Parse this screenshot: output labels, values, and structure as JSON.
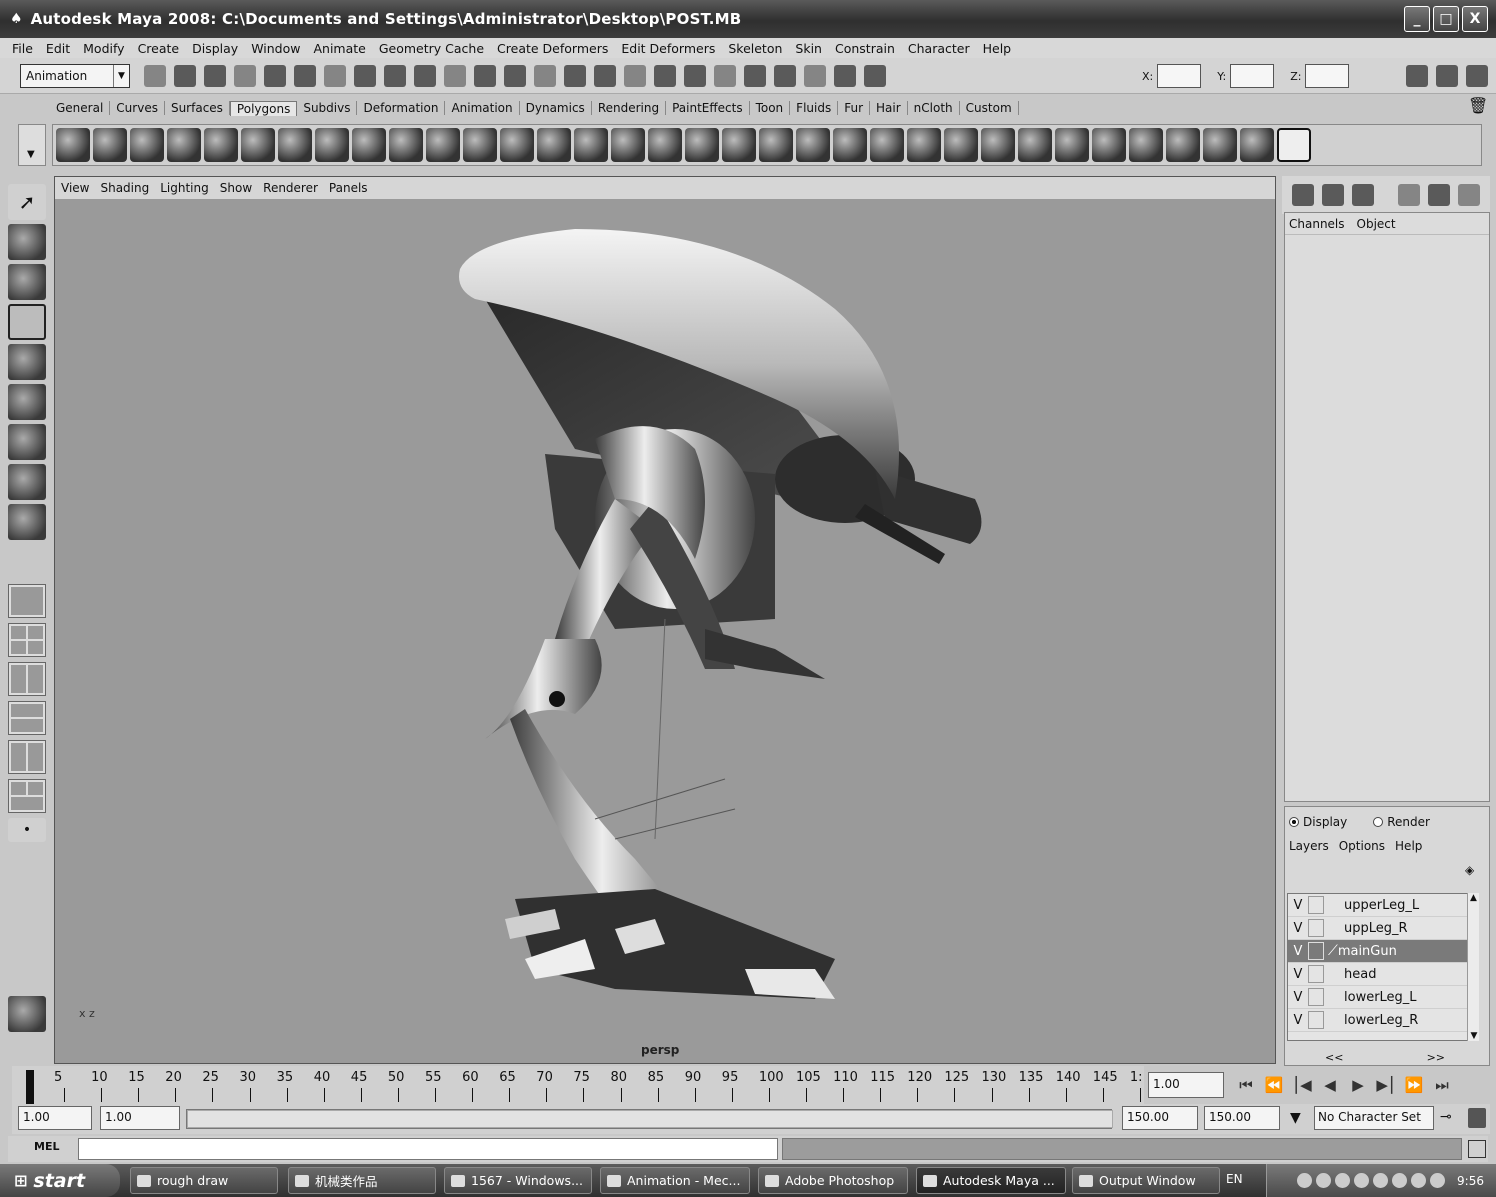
{
  "window": {
    "title": "Autodesk Maya 2008: C:\\Documents and Settings\\Administrator\\Desktop\\POST.MB",
    "minimize": "_",
    "maximize": "□",
    "close": "X"
  },
  "menubar": [
    "File",
    "Edit",
    "Modify",
    "Create",
    "Display",
    "Window",
    "Animate",
    "Geometry Cache",
    "Create Deformers",
    "Edit Deformers",
    "Skeleton",
    "Skin",
    "Constrain",
    "Character",
    "Help"
  ],
  "statusline": {
    "menu_set": "Animation",
    "x_label": "X:",
    "y_label": "Y:",
    "z_label": "Z:"
  },
  "shelf_tabs": [
    "General",
    "Curves",
    "Surfaces",
    "Polygons",
    "Subdivs",
    "Deformation",
    "Animation",
    "Dynamics",
    "Rendering",
    "PaintEffects",
    "Toon",
    "Fluids",
    "Fur",
    "Hair",
    "nCloth",
    "Custom"
  ],
  "shelf_active": "Polygons",
  "viewport": {
    "menu": [
      "View",
      "Shading",
      "Lighting",
      "Show",
      "Renderer",
      "Panels"
    ],
    "camera": "persp",
    "axis": "x  z"
  },
  "channel_box": {
    "menu": [
      "Channels",
      "Object"
    ]
  },
  "layer_editor": {
    "mode_display": "Display",
    "mode_render": "Render",
    "menu": [
      "Layers",
      "Options",
      "Help"
    ],
    "layers": [
      {
        "vis": "V",
        "name": "upperLeg_L",
        "selected": false
      },
      {
        "vis": "V",
        "name": "uppLeg_R",
        "selected": false
      },
      {
        "vis": "V",
        "name": "mainGun",
        "selected": true
      },
      {
        "vis": "V",
        "name": "head",
        "selected": false
      },
      {
        "vis": "V",
        "name": "lowerLeg_L",
        "selected": false
      },
      {
        "vis": "V",
        "name": "lowerLeg_R",
        "selected": false
      }
    ],
    "nav_prev": "<<",
    "nav_next": ">>"
  },
  "timeline": {
    "ticks": [
      "5",
      "10",
      "15",
      "20",
      "25",
      "30",
      "35",
      "40",
      "45",
      "50",
      "55",
      "60",
      "65",
      "70",
      "75",
      "80",
      "85",
      "90",
      "95",
      "100",
      "105",
      "110",
      "115",
      "120",
      "125",
      "130",
      "135",
      "140",
      "145",
      "1:"
    ],
    "current_frame": "1.00"
  },
  "range": {
    "start_time": "1.00",
    "playback_start": "1.00",
    "playback_end": "150.00",
    "end_time": "150.00",
    "character_set": "No Character Set"
  },
  "command_line": {
    "label": "MEL"
  },
  "taskbar": {
    "start": "start",
    "tasks": [
      "rough draw",
      "机械类作品",
      "1567 - Windows...",
      "Animation - Mec...",
      "Adobe Photoshop",
      "Autodesk Maya ...",
      "Output Window"
    ],
    "lang": "EN",
    "clock": "9:56"
  },
  "colors": {
    "viewport_bg": "#9a9a9a",
    "panel_bg": "#d6d6d6",
    "selection": "#7a7a7a",
    "taskbar": "#3c3c3c"
  }
}
